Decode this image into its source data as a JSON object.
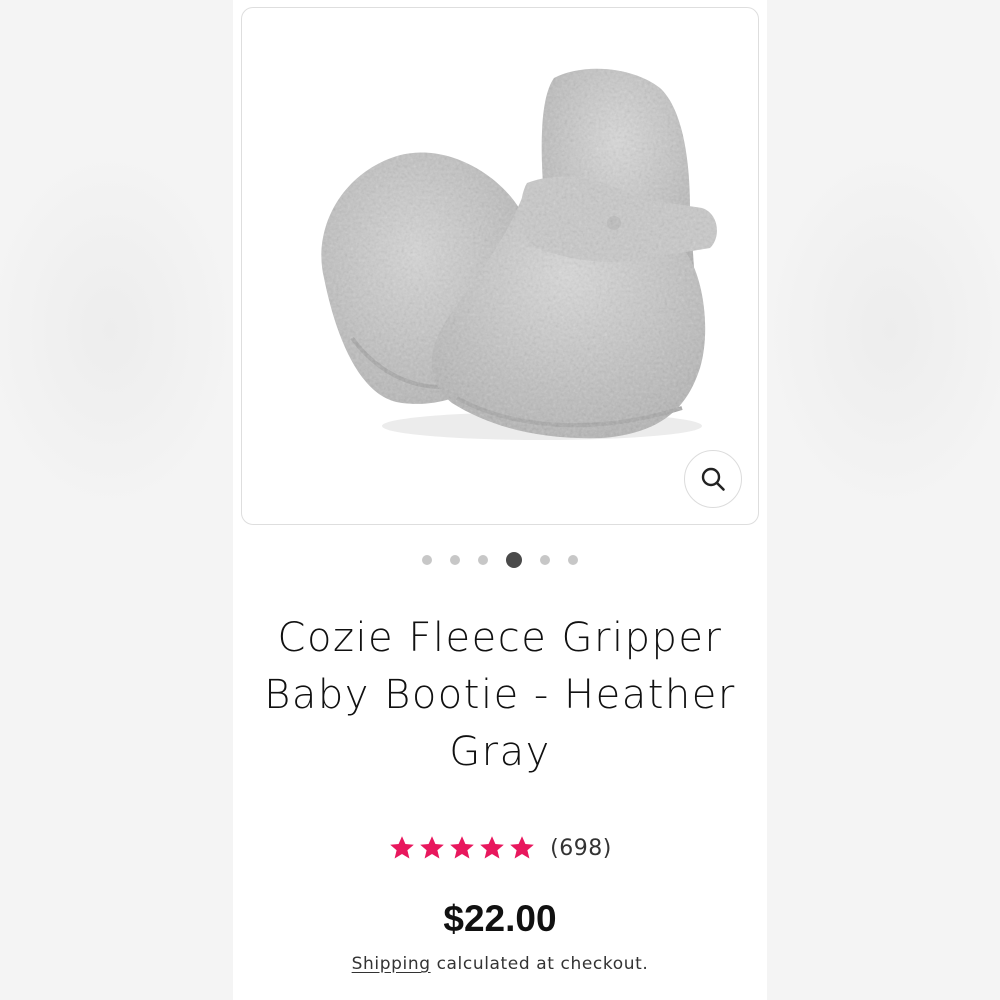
{
  "product": {
    "title": "Cozie Fleece Gripper Baby Bootie - Heather Gray",
    "rating": 5,
    "rating_max": 5,
    "review_count": "(698)",
    "price": "$22.00",
    "shipping_link": "Shipping",
    "shipping_text": " calculated at checkout."
  },
  "gallery": {
    "image_count": 6,
    "active_index": 3,
    "zoom_icon": "search-icon"
  },
  "colors": {
    "star": "#e8175d",
    "dot_inactive": "#c7c7c7",
    "dot_active": "#4a4a4a"
  }
}
